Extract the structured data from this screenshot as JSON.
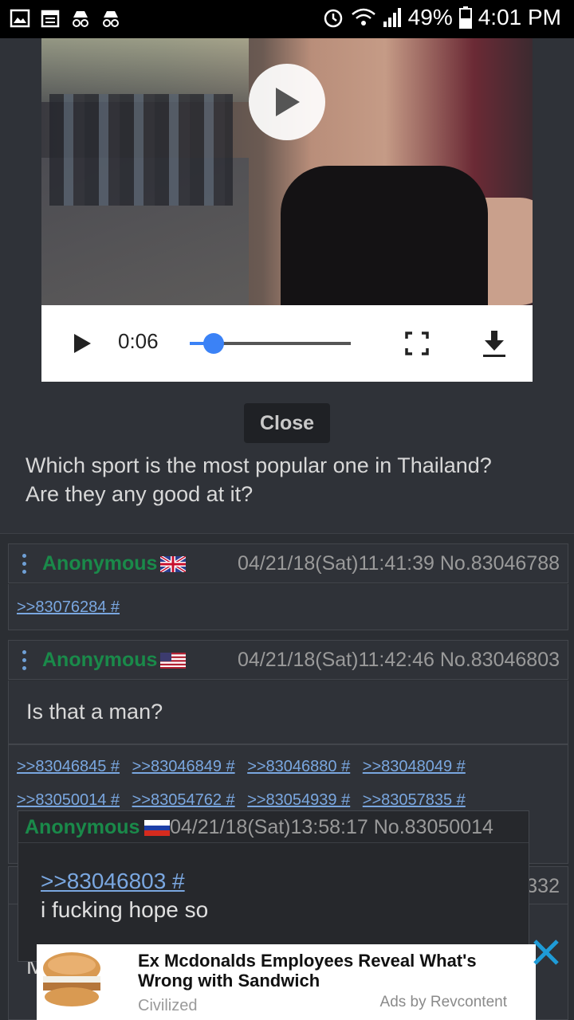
{
  "status_bar": {
    "battery": "49%",
    "time": "4:01 PM",
    "icons": [
      "image-icon",
      "calendar-icon",
      "incognito-icon",
      "incognito-icon",
      "alarm-icon",
      "wifi-icon",
      "signal-icon",
      "battery-icon"
    ]
  },
  "video": {
    "time": "0:06",
    "progress": 0.15,
    "accent": "#3b82f6"
  },
  "op": {
    "close_label": "Close",
    "text_line1": "Which sport is the most popular one in Thailand?",
    "text_line2": "Are they any good at it?"
  },
  "posts": [
    {
      "name": "Anonymous",
      "flag": "uk-flag",
      "meta": "04/21/18(Sat)11:41:39 No.83046788",
      "replies": [
        ">>83076284 #"
      ]
    },
    {
      "name": "Anonymous",
      "flag": "us-flag",
      "meta": "04/21/18(Sat)11:42:46 No.83046803",
      "text": "Is that a man?",
      "replies_row1": [
        ">>83046845 #",
        ">>83046849 #",
        ">>83046880 #",
        ">>83048049 #"
      ],
      "replies_row2": [
        ">>83050014 #",
        ">>83054762 #",
        ">>83054939 #",
        ">>83057835 #"
      ]
    }
  ],
  "popup": {
    "name": "Anonymous",
    "flag": "ru-flag",
    "meta": "04/21/18(Sat)13:58:17 No.83050014",
    "link": ">>83046803 #",
    "text": "i fucking hope so"
  },
  "under_post": {
    "meta_end": "332",
    "body_letter": "M"
  },
  "ad": {
    "title": "Ex Mcdonalds Employees Reveal What's Wrong with Sandwich",
    "source": "Civilized",
    "by": "Ads by Revcontent",
    "close_color": "#1e9bd7"
  },
  "colors": {
    "name_green": "#1a8a4a",
    "link_blue": "#7aa7e0",
    "background": "#2b2e33"
  }
}
